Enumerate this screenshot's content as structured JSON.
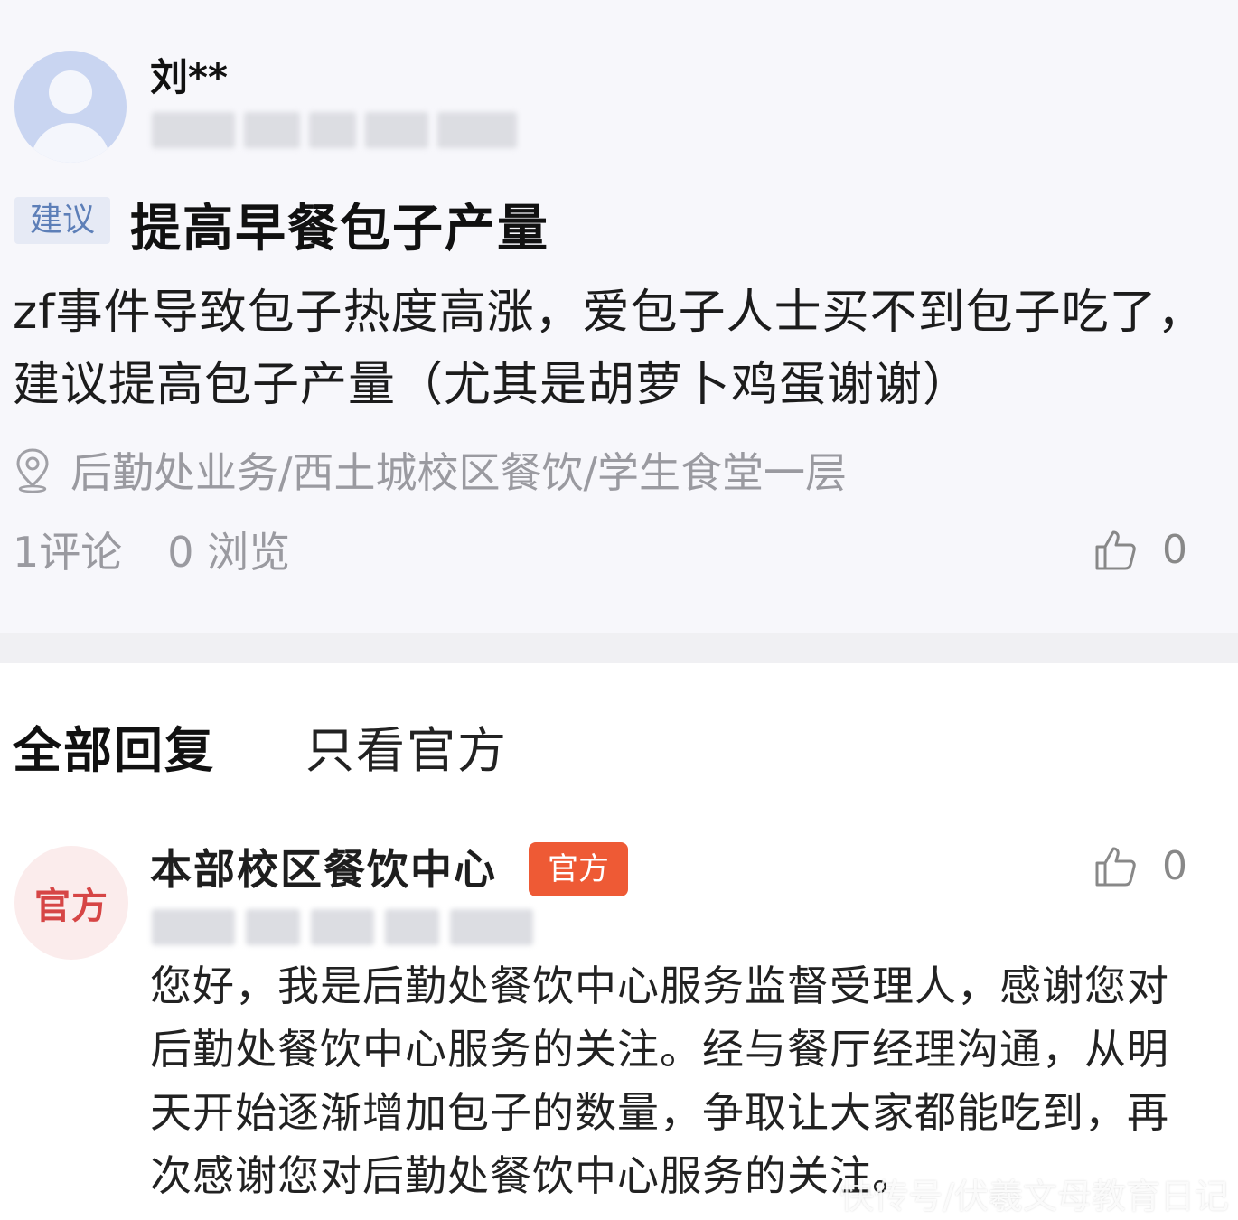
{
  "post": {
    "author": "刘**",
    "tag": "建议",
    "title": "提高早餐包子产量",
    "body": "zf事件导致包子热度高涨，爱包子人士买不到包子吃了，建议提高包子产量（尤其是胡萝卜鸡蛋谢谢）",
    "location": "后勤处业务/西土城校区餐饮/学生食堂一层",
    "comments": "1评论",
    "views": "0 浏览",
    "likes": "0"
  },
  "tabs": {
    "all": "全部回复",
    "official_only": "只看官方"
  },
  "reply": {
    "avatar_text": "官方",
    "author": "本部校区餐饮中心",
    "badge": "官方",
    "likes": "0",
    "body": "您好，我是后勤处餐饮中心服务监督受理人，感谢您对后勤处餐饮中心服务的关注。经与餐厅经理沟通，从明天开始逐渐增加包子的数量，争取让大家都能吃到，再次感谢您对后勤处餐饮中心服务的关注。"
  },
  "watermark": "快传号/伏羲文母教育日记",
  "colors": {
    "tag_bg": "#e6eaf5",
    "tag_text": "#5d7fb8",
    "official_badge": "#ee5a35",
    "official_avatar_text": "#d64545"
  }
}
